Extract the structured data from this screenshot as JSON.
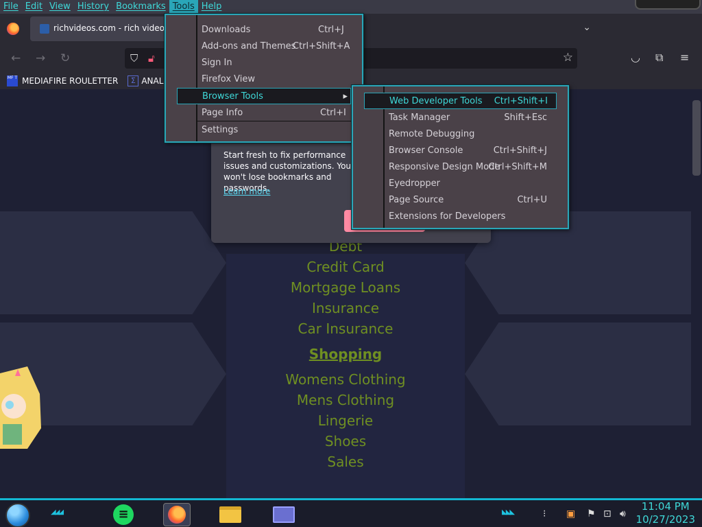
{
  "menubar": {
    "items": [
      "File",
      "Edit",
      "View",
      "History",
      "Bookmarks",
      "Tools",
      "Help"
    ],
    "active": "Tools"
  },
  "tab": {
    "title": "richvideos.com - rich videos R"
  },
  "bookmarks": [
    {
      "label": "MEDIAFIRE ROULETTER",
      "icon_text": "MF T"
    },
    {
      "label": "ANAL PRO",
      "icon_text": "Σ"
    }
  ],
  "popup": {
    "text": "Start fresh to fix performance issues and customizations. You won't lose bookmarks and passwords.",
    "link": "Learn more"
  },
  "tools_menu": {
    "items": [
      {
        "label": "Downloads",
        "shortcut": "Ctrl+J",
        "u": "D"
      },
      {
        "label": "Add-ons and Themes",
        "shortcut": "Ctrl+Shift+A",
        "u": "A"
      },
      {
        "label": "Sign In",
        "shortcut": "",
        "u": ""
      },
      {
        "label": "Firefox View",
        "shortcut": "",
        "u": "F"
      },
      {
        "label": "Browser Tools",
        "shortcut": "",
        "u": "B",
        "submenu": true
      },
      {
        "label": "Page Info",
        "shortcut": "Ctrl+I",
        "u": "I"
      },
      {
        "label": "Settings",
        "shortcut": "",
        "u": "S"
      }
    ]
  },
  "browser_tools_menu": {
    "items": [
      {
        "label": "Web Developer Tools",
        "shortcut": "Ctrl+Shift+I"
      },
      {
        "label": "Task Manager",
        "shortcut": "Shift+Esc"
      },
      {
        "label": "Remote Debugging",
        "shortcut": ""
      },
      {
        "label": "Browser Console",
        "shortcut": "Ctrl+Shift+J"
      },
      {
        "label": "Responsive Design Mode",
        "shortcut": "Ctrl+Shift+M"
      },
      {
        "label": "Eyedropper",
        "shortcut": ""
      },
      {
        "label": "Page Source",
        "shortcut": "Ctrl+U"
      },
      {
        "label": "Extensions for Developers",
        "shortcut": ""
      }
    ]
  },
  "page_links": {
    "finance": [
      "Debt",
      "Credit Card",
      "Mortgage Loans",
      "Insurance",
      "Car Insurance"
    ],
    "shopping_header": "Shopping",
    "shopping": [
      "Womens Clothing",
      "Mens Clothing",
      "Lingerie",
      "Shoes",
      "Sales"
    ]
  },
  "clock": {
    "time": "11:04 PM",
    "date": "10/27/2023"
  },
  "colors": {
    "accent": "#2aa6b8",
    "link_green": "#6f8f22",
    "menu_bg": "#4a4148"
  }
}
